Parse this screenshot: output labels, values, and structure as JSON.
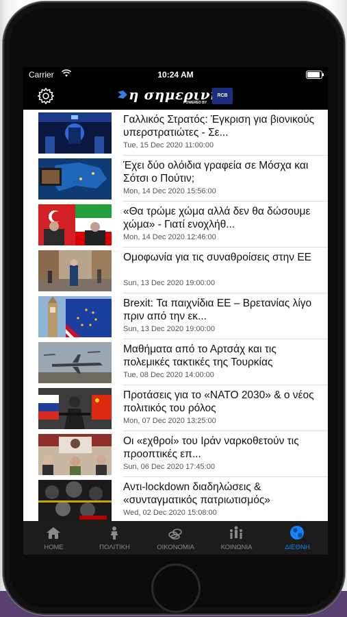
{
  "status_bar": {
    "carrier": "Carrier",
    "time": "10:24 AM"
  },
  "header": {
    "logo_text": "η σημερινή",
    "logo_powered": "POWERED BY",
    "logo_badge": "RCB"
  },
  "articles": [
    {
      "title": "Γαλλικός Στρατός: Έγκριση για βιονικούς υπερστρατιώτες - Σε...",
      "date": "Tue, 15 Dec 2020 11:00:00"
    },
    {
      "title": "Έχει δύο ολόιδια γραφεία σε Μόσχα και Σότσι ο Πούτιν;",
      "date": "Mon, 14 Dec 2020 15:56:00"
    },
    {
      "title": "«Θα τρώμε χώμα αλλά δεν θα δώσουμε χώμα» - Γιατί ενοχλήθ...",
      "date": "Mon, 14 Dec 2020 12:46:00"
    },
    {
      "title": "Ομοφωνία για τις συναθροίσεις στην ΕΕ",
      "date": "Sun, 13 Dec 2020 19:00:00"
    },
    {
      "title": "Brexit: Τα παιχνίδια ΕΕ – Βρετανίας λίγο πριν από την εκ...",
      "date": "Sun, 13 Dec 2020 19:00:00"
    },
    {
      "title": "Μαθήματα από το Αρτσάχ και τις πολεμικές τακτικές της Τουρκίας",
      "date": "Tue, 08 Dec 2020 14:00:00"
    },
    {
      "title": "Προτάσεις για το «ΝΑΤΟ 2030» & ο νέος πολιτικός του ρόλος",
      "date": "Mon, 07 Dec 2020 13:25:00"
    },
    {
      "title": "Οι «εχθροί» του Ιράν ναρκοθετούν τις προοπτικές επ...",
      "date": "Sun, 06 Dec 2020 17:45:00"
    },
    {
      "title": "Αντι-lockdown διαδηλώσεις & «συνταγματικός πατριωτισμός»",
      "date": "Wed, 02 Dec 2020 15:08:00"
    }
  ],
  "tabs": [
    {
      "label": "HOME",
      "icon": "home-icon"
    },
    {
      "label": "ΠΟΛΙΤΙΚΗ",
      "icon": "politics-icon"
    },
    {
      "label": "ΟΙΚΟΝΟΜΙΑ",
      "icon": "economy-icon"
    },
    {
      "label": "ΚΟΙΝΩΝΙΑ",
      "icon": "society-icon"
    },
    {
      "label": "ΔΙΕΘΝΗ",
      "icon": "globe-icon"
    }
  ],
  "active_tab": "ΔΙΕΘΝΗ",
  "colors": {
    "accent": "#1a82f7",
    "bar_background": "#000000",
    "tabbar_background": "#1c1c1c"
  }
}
